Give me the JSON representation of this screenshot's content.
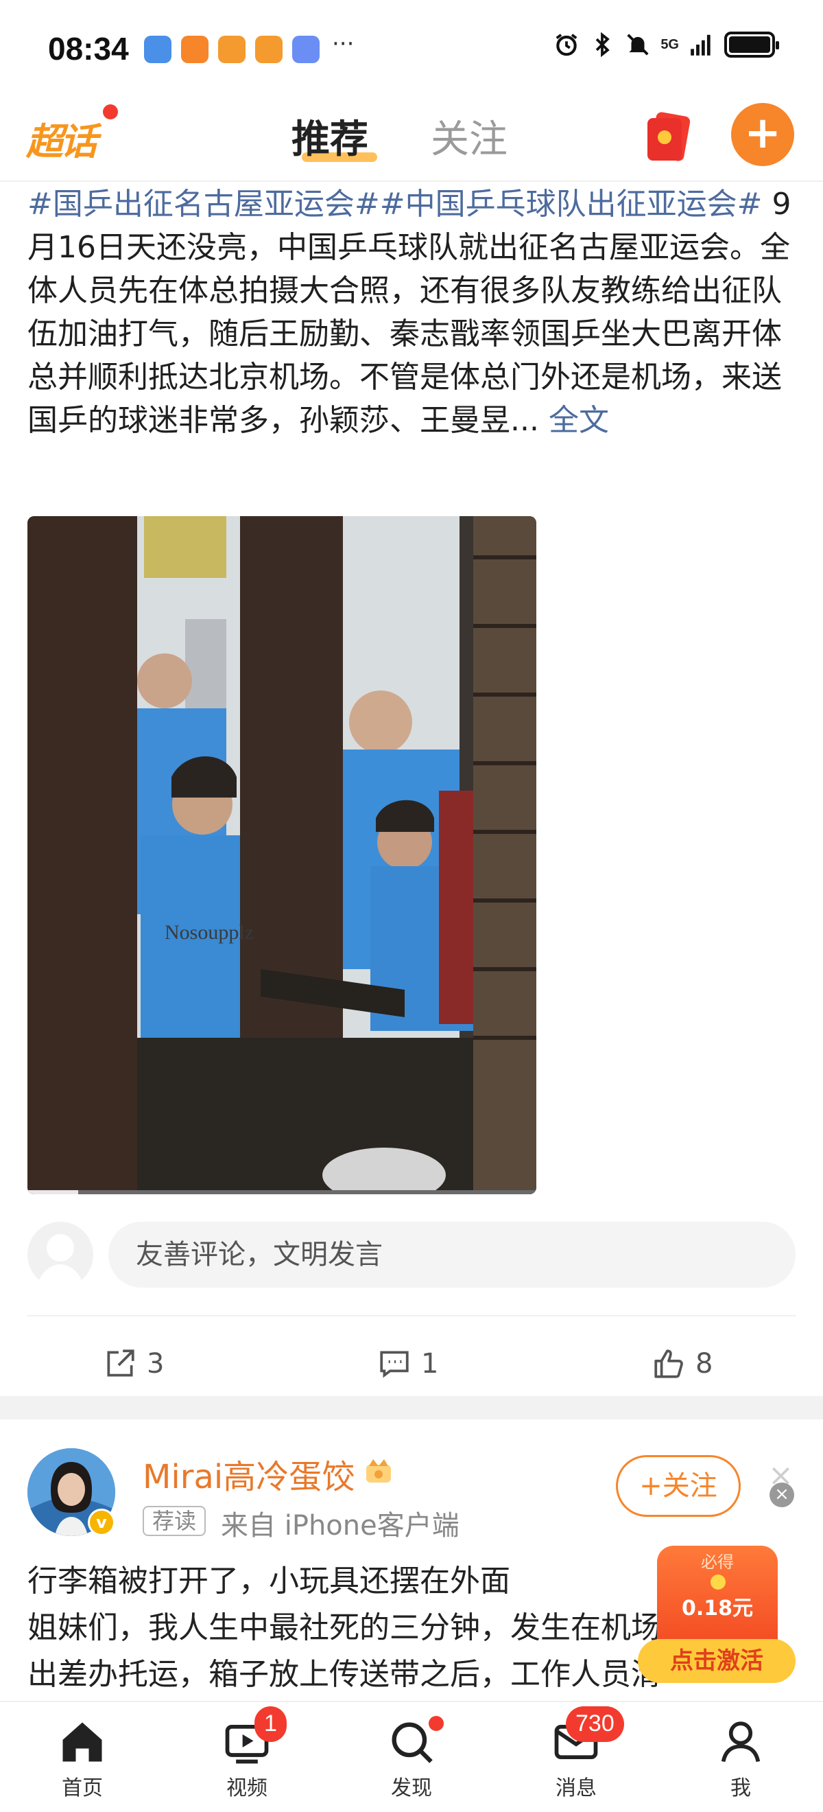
{
  "status_bar": {
    "time": "08:34",
    "more": "···",
    "network": "5G"
  },
  "header": {
    "logo": "超话",
    "tabs": [
      {
        "label": "推荐",
        "active": true
      },
      {
        "label": "关注",
        "active": false
      }
    ],
    "add_label": "+"
  },
  "post": {
    "hashtags": "#国乒出征名古屋亚运会##中国乒乓球队出征亚运会#",
    "body": " 9月16日天还没亮，中国乒乓球队就出征名古屋亚运会。全体人员先在体总拍摄大合照，还有很多队友教练给出征队伍加油打气，随后王励勤、秦志戬率领国乒坐大巴离开体总并顺利抵达北京机场。不管是体总门外还是机场，来送国乒的球迷非常多，孙颖莎、王曼昱... ",
    "more_link": "全文",
    "watermark": "Nosoupplz",
    "comment_placeholder": "友善评论，文明发言",
    "actions": {
      "share_count": "3",
      "comment_count": "1",
      "like_count": "8"
    }
  },
  "post2": {
    "author": "Mirai高冷蛋饺",
    "badge": "荐读",
    "source": "来自 iPhone客户端",
    "follow_label": "+关注",
    "close": "×",
    "lines": [
      "行李箱被打开了，小玩具还摆在外面",
      "姐妹们，我人生中最社死的三分钟，发生在机场。",
      "出差办托运，箱子放上传送带之后，工作人员清"
    ]
  },
  "promo": {
    "label": "必得",
    "amount": "0.18元",
    "cta": "点击激活",
    "close": "×"
  },
  "bottom_nav": [
    {
      "label": "首页",
      "icon": "home-icon",
      "badge": ""
    },
    {
      "label": "视频",
      "icon": "video-icon",
      "badge": "1"
    },
    {
      "label": "发现",
      "icon": "discover-icon",
      "badge": ""
    },
    {
      "label": "消息",
      "icon": "message-icon",
      "badge": "730"
    },
    {
      "label": "我",
      "icon": "profile-icon",
      "badge": ""
    }
  ],
  "colors": {
    "brand_orange": "#f7852a",
    "hashtag_blue": "#4d6b9e",
    "badge_red": "#f23b2e"
  }
}
